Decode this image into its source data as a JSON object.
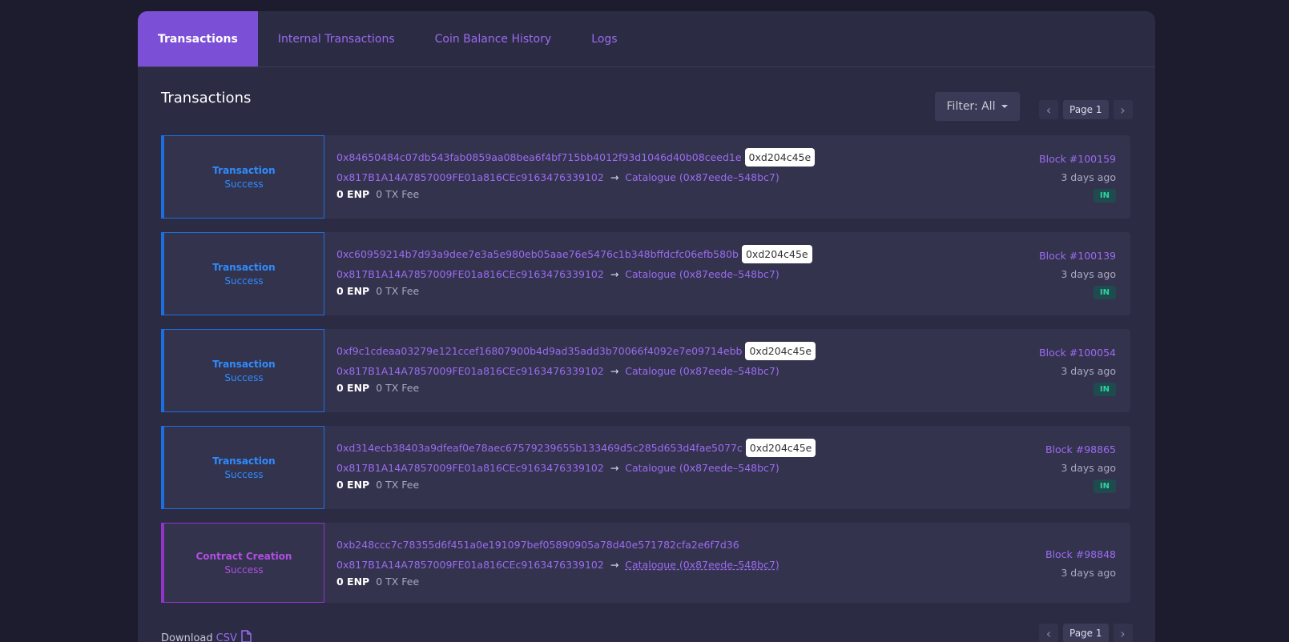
{
  "tabs": [
    "Transactions",
    "Internal Transactions",
    "Coin Balance History",
    "Logs"
  ],
  "section_title": "Transactions",
  "filter_label": "Filter: All",
  "pagination": {
    "page_label": "Page 1"
  },
  "transactions": [
    {
      "type": "Transaction",
      "status": "Success",
      "hash": "0x84650484c07db543fab0859aa08bea6f4bf715bb4012f93d1046d40b08ceed1e",
      "method": "0xd204c45e",
      "from": "0x817B1A14A7857009FE01a816CEc9163476339102",
      "arrow": "→",
      "to": "Catalogue (0x87eede–548bc7)",
      "value": "0 ENP",
      "fee": "0 TX Fee",
      "block": "Block #100159",
      "age": "3 days ago",
      "direction": "IN"
    },
    {
      "type": "Transaction",
      "status": "Success",
      "hash": "0xc60959214b7d93a9dee7e3a5e980eb05aae76e5476c1b348bffdcfc06efb580b",
      "method": "0xd204c45e",
      "from": "0x817B1A14A7857009FE01a816CEc9163476339102",
      "arrow": "→",
      "to": "Catalogue (0x87eede–548bc7)",
      "value": "0 ENP",
      "fee": "0 TX Fee",
      "block": "Block #100139",
      "age": "3 days ago",
      "direction": "IN"
    },
    {
      "type": "Transaction",
      "status": "Success",
      "hash": "0xf9c1cdeaa03279e121ccef16807900b4d9ad35add3b70066f4092e7e09714ebb",
      "method": "0xd204c45e",
      "from": "0x817B1A14A7857009FE01a816CEc9163476339102",
      "arrow": "→",
      "to": "Catalogue (0x87eede–548bc7)",
      "value": "0 ENP",
      "fee": "0 TX Fee",
      "block": "Block #100054",
      "age": "3 days ago",
      "direction": "IN"
    },
    {
      "type": "Transaction",
      "status": "Success",
      "hash": "0xd314ecb38403a9dfeaf0e78aec67579239655b133469d5c285d653d4fae5077c",
      "method": "0xd204c45e",
      "from": "0x817B1A14A7857009FE01a816CEc9163476339102",
      "arrow": "→",
      "to": "Catalogue (0x87eede–548bc7)",
      "value": "0 ENP",
      "fee": "0 TX Fee",
      "block": "Block #98865",
      "age": "3 days ago",
      "direction": "IN"
    },
    {
      "type": "Contract Creation",
      "status": "Success",
      "hash": "0xb248ccc7c78355d6f451a0e191097bef05890905a78d40e571782cfa2e6f7d36",
      "from": "0x817B1A14A7857009FE01a816CEc9163476339102",
      "arrow": "→",
      "to": "Catalogue (0x87eede–548bc7)",
      "value": "0 ENP",
      "fee": "0 TX Fee",
      "block": "Block #98848",
      "age": "3 days ago"
    }
  ],
  "download": {
    "prefix": "Download",
    "link": "CSV"
  },
  "icons": {
    "prev": "chevron-left-icon",
    "next": "chevron-right-icon",
    "dropdown": "caret-down-icon",
    "file": "file-icon"
  },
  "colors": {
    "background": "#1c1c2e",
    "card": "#2b2b44",
    "accent": "#7b4fd6",
    "link": "#9b6bf0",
    "transaction": "#2f8cff",
    "contract": "#b04fe0",
    "in_badge": "#2ed3a6"
  }
}
